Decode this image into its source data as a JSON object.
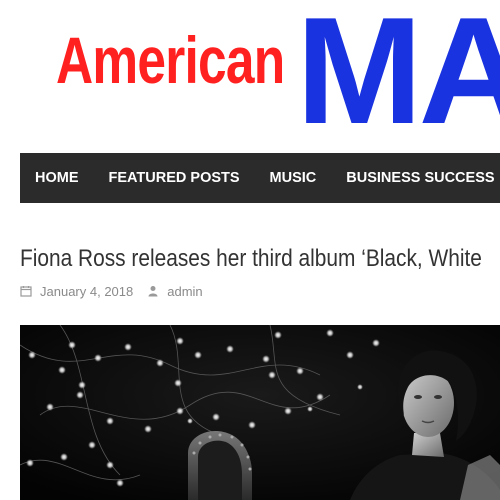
{
  "logo": {
    "part1": "American",
    "part2": "MAG",
    "colors": {
      "part1": "#ff2020",
      "part2": "#1a33e0"
    }
  },
  "nav": {
    "items": [
      {
        "label": "HOME"
      },
      {
        "label": "FEATURED POSTS"
      },
      {
        "label": "MUSIC"
      },
      {
        "label": "BUSINESS SUCCESS"
      }
    ],
    "background": "#2b2b2b"
  },
  "article": {
    "title": "Fiona Ross releases her third album ‘Black, White",
    "date": "January 4, 2018",
    "author": "admin",
    "date_icon": "calendar-icon",
    "author_icon": "user-icon"
  },
  "hero_image": {
    "description_icon": "photo-icon"
  }
}
